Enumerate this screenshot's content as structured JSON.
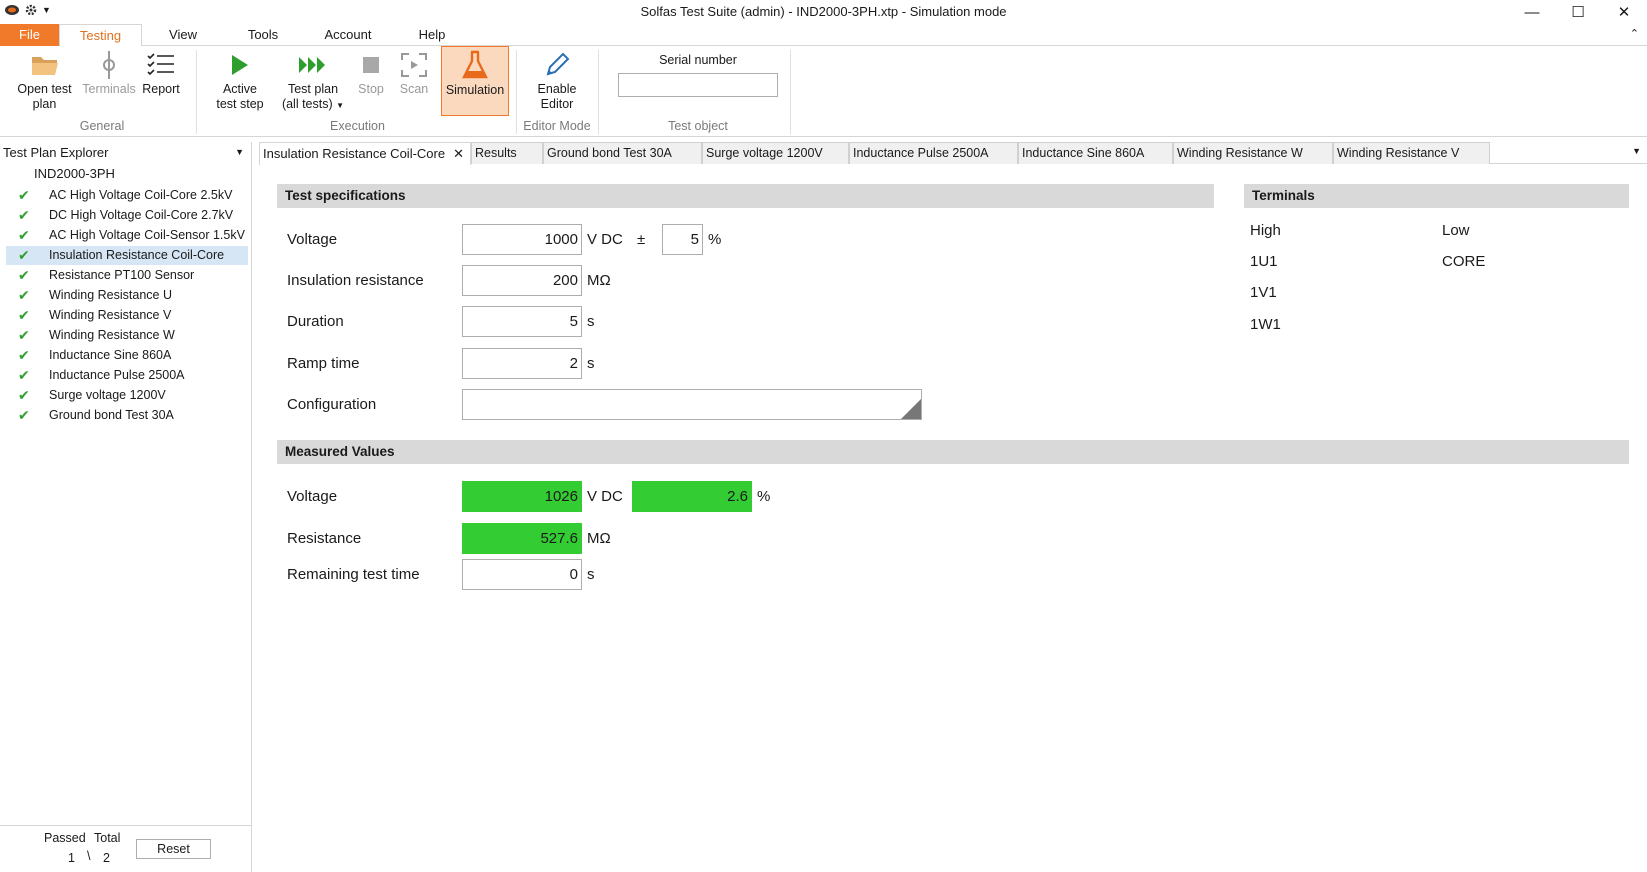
{
  "window": {
    "title": "Solfas Test Suite (admin)  - IND2000-3PH.xtp - Simulation mode"
  },
  "ribbon_tabs": [
    "File",
    "Testing",
    "View",
    "Tools",
    "Account",
    "Help"
  ],
  "ribbon": {
    "open_test_plan": "Open test plan",
    "terminals": "Terminals",
    "report": "Report",
    "group_general": "General",
    "active_test_step_1": "Active",
    "active_test_step_2": "test step",
    "test_plan_1": "Test plan",
    "test_plan_2": "(all tests)",
    "stop": "Stop",
    "scan": "Scan",
    "simulation": "Simulation",
    "group_execution": "Execution",
    "enable_editor_1": "Enable",
    "enable_editor_2": "Editor",
    "group_editor_mode": "Editor Mode",
    "serial_number_label": "Serial number",
    "serial_number_value": "",
    "group_test_object": "Test object"
  },
  "explorer": {
    "header": "Test Plan Explorer",
    "root": "IND2000-3PH",
    "items": [
      {
        "label": "AC High Voltage Coil-Core 2.5kV",
        "passed": true
      },
      {
        "label": "DC High Voltage Coil-Core 2.7kV",
        "passed": true
      },
      {
        "label": "AC High Voltage Coil-Sensor 1.5kV",
        "passed": true
      },
      {
        "label": "Insulation Resistance Coil-Core",
        "passed": true,
        "selected": true
      },
      {
        "label": "Resistance PT100 Sensor",
        "passed": true
      },
      {
        "label": "Winding Resistance U",
        "passed": true
      },
      {
        "label": "Winding Resistance  V",
        "passed": true
      },
      {
        "label": "Winding Resistance  W",
        "passed": true
      },
      {
        "label": "Inductance Sine 860A",
        "passed": true
      },
      {
        "label": "Inductance Pulse 2500A",
        "passed": true
      },
      {
        "label": "Surge voltage 1200V",
        "passed": true
      },
      {
        "label": "Ground bond Test 30A",
        "passed": true
      }
    ],
    "stats": {
      "passed_label": "Passed",
      "total_label": "Total",
      "passed": "1",
      "sep": "\\",
      "total": "2"
    },
    "reset": "Reset"
  },
  "doc_tabs": [
    "Insulation Resistance Coil-Core",
    "Results",
    "Ground bond Test 30A",
    "Surge voltage 1200V",
    "Inductance Pulse 2500A",
    "Inductance Sine 860A",
    "Winding Resistance  W",
    "Winding Resistance  V"
  ],
  "spec": {
    "header": "Test specifications",
    "voltage_label": "Voltage",
    "voltage_value": "1000",
    "voltage_unit": "V DC",
    "tolerance_sign": "±",
    "tolerance_value": "5",
    "tolerance_unit": "%",
    "insulation_label": "Insulation resistance",
    "insulation_value": "200",
    "insulation_unit": "MΩ",
    "duration_label": "Duration",
    "duration_value": "5",
    "duration_unit": "s",
    "ramp_label": "Ramp time",
    "ramp_value": "2",
    "ramp_unit": "s",
    "config_label": "Configuration",
    "config_value": ""
  },
  "terminals": {
    "header": "Terminals",
    "high_label": "High",
    "low_label": "Low",
    "high": [
      "1U1",
      "1V1",
      "1W1"
    ],
    "low": [
      "CORE"
    ]
  },
  "measured": {
    "header": "Measured Values",
    "voltage_label": "Voltage",
    "voltage_value": "1026",
    "voltage_unit": "V DC",
    "deviation_value": "2.6",
    "deviation_unit": "%",
    "resistance_label": "Resistance",
    "resistance_value": "527.6",
    "resistance_unit": "MΩ",
    "remaining_label": "Remaining test time",
    "remaining_value": "0",
    "remaining_unit": "s"
  },
  "colors": {
    "accent": "#f07a2a",
    "pass_green": "#33cc33",
    "check_green": "#2e9e2e"
  }
}
